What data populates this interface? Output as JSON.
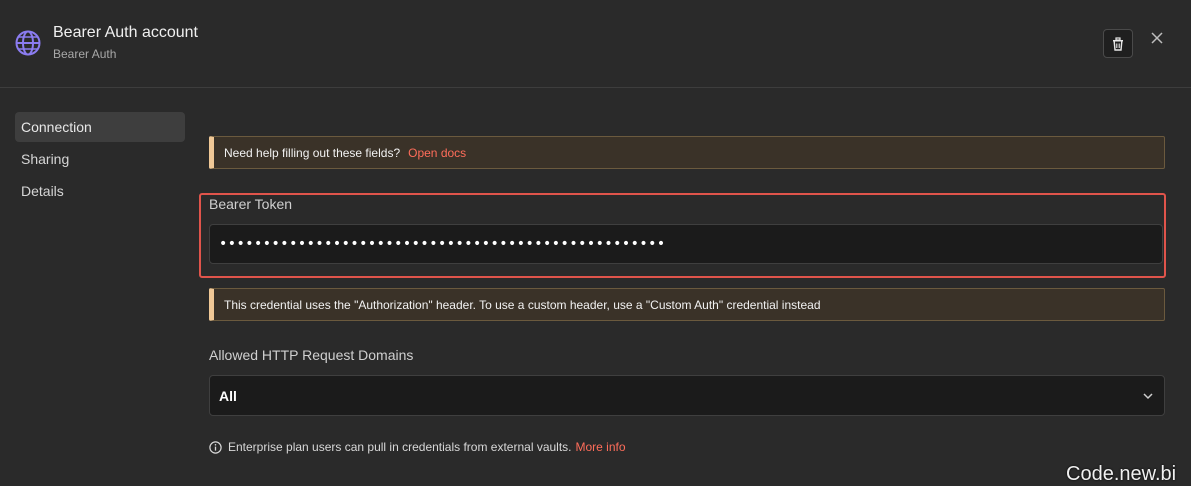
{
  "header": {
    "title": "Bearer Auth account",
    "subtitle": "Bearer Auth",
    "icon": "globe-icon",
    "trash_icon": "trash-icon",
    "close_icon": "close-icon"
  },
  "sidebar": {
    "items": [
      {
        "label": "Connection",
        "active": true
      },
      {
        "label": "Sharing",
        "active": false
      },
      {
        "label": "Details",
        "active": false
      }
    ]
  },
  "help_notice": {
    "text": "Need help filling out these fields?",
    "link": "Open docs"
  },
  "bearer_token": {
    "label": "Bearer Token",
    "value": "•••••••••••••••••••••••••••••••••••••••••••••••••••"
  },
  "auth_notice": {
    "text": "This credential uses the \"Authorization\" header. To use a custom header, use a \"Custom Auth\" credential instead"
  },
  "domains": {
    "label": "Allowed HTTP Request Domains",
    "selected": "All"
  },
  "footer_note": {
    "text": "Enterprise plan users can pull in credentials from external vaults.",
    "link": "More info"
  },
  "watermark": "Code.new.bi",
  "colors": {
    "accent": "#ff6d5a",
    "highlight_border": "#e0544b",
    "notice_bar": "#f0c896",
    "background": "#2a2a2a"
  }
}
